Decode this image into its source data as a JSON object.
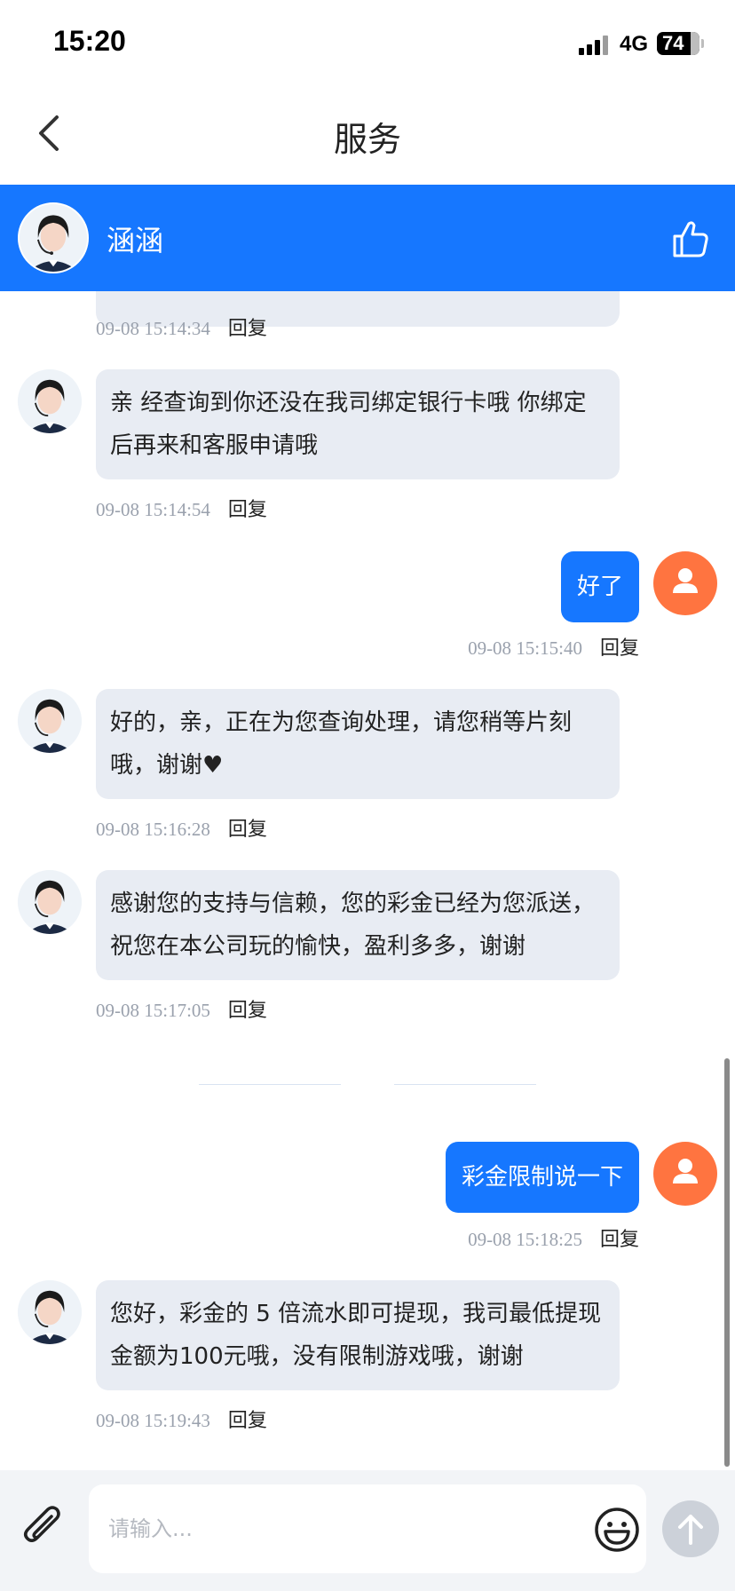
{
  "status_bar": {
    "time": "15:20",
    "network": "4G",
    "battery": "74"
  },
  "nav": {
    "title": "服务",
    "back_icon": "chevron-left-icon"
  },
  "agent": {
    "name": "涵涵",
    "like_icon": "thumbs-up-icon"
  },
  "colors": {
    "accent": "#1677ff",
    "agent_bubble": "#e8ecf3",
    "user_avatar": "#ff7440",
    "timestamp": "#9aa1ad"
  },
  "reply_label": "回复",
  "messages": [
    {
      "from": "agent",
      "time": "09-08 15:14:34",
      "text": ""
    },
    {
      "from": "agent",
      "time": "09-08 15:14:54",
      "text": "亲 经查询到你还没在我司绑定银行卡哦 你绑定后再来和客服申请哦"
    },
    {
      "from": "user",
      "time": "09-08 15:15:40",
      "text": "好了"
    },
    {
      "from": "agent",
      "time": "09-08 15:16:28",
      "text": "好的，亲，正在为您查询处理，请您稍等片刻哦，谢谢♥"
    },
    {
      "from": "agent",
      "time": "09-08 15:17:05",
      "text": "感谢您的支持与信赖，您的彩金已经为您派送，祝您在本公司玩的愉快，盈利多多，谢谢"
    },
    {
      "from": "user",
      "time": "09-08 15:18:25",
      "text": "彩金限制说一下"
    },
    {
      "from": "agent",
      "time": "09-08 15:19:43",
      "text": "您好，彩金的 5 倍流水即可提现，我司最低提现金额为100元哦，没有限制游戏哦，谢谢"
    }
  ],
  "input": {
    "placeholder": "请输入...",
    "value": ""
  }
}
